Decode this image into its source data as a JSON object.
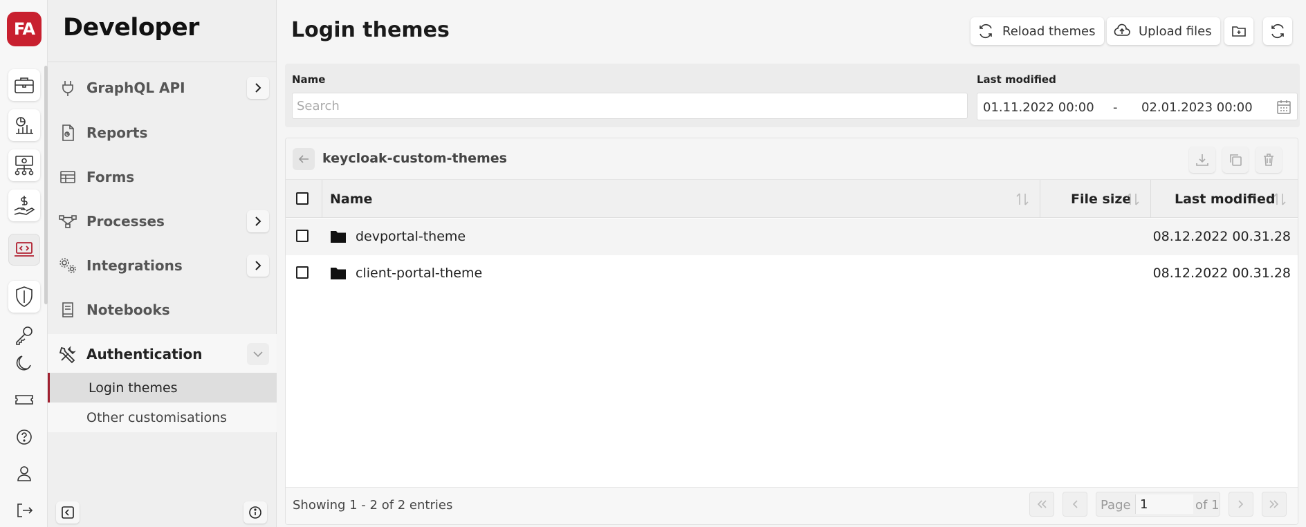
{
  "app": {
    "logo_text": "FA",
    "section_title": "Developer"
  },
  "rail": {
    "icons": [
      "briefcase-icon",
      "reports-chart-icon",
      "money-network-icon",
      "hand-dollar-icon",
      "developer-laptop-icon",
      "shield-icon",
      "key-icon",
      "moon-icon",
      "ticket-icon",
      "help-icon",
      "user-icon",
      "logout-icon"
    ]
  },
  "sidebar": {
    "items": [
      {
        "label": "GraphQL API",
        "icon": "plug-icon"
      },
      {
        "label": "Reports",
        "icon": "report-file-icon"
      },
      {
        "label": "Forms",
        "icon": "table-icon"
      },
      {
        "label": "Processes",
        "icon": "process-icon"
      },
      {
        "label": "Integrations",
        "icon": "gears-icon"
      },
      {
        "label": "Notebooks",
        "icon": "notebook-icon"
      },
      {
        "label": "Authentication",
        "icon": "tools-icon"
      }
    ],
    "subitems": [
      {
        "label": "Login themes"
      },
      {
        "label": "Other customisations"
      }
    ]
  },
  "page": {
    "title": "Login themes",
    "reload_label": "Reload themes",
    "upload_label": "Upload files"
  },
  "filters": {
    "name_label": "Name",
    "search_placeholder": "Search",
    "modified_label": "Last modified",
    "date_from": "01.11.2022 00:00",
    "date_sep": "-",
    "date_to": "02.01.2023 00:00"
  },
  "browser": {
    "path": "keycloak-custom-themes",
    "columns": {
      "name": "Name",
      "size": "File size",
      "modified": "Last modified"
    },
    "rows": [
      {
        "name": "devportal-theme",
        "size": "",
        "modified": "08.12.2022 00.31.28"
      },
      {
        "name": "client-portal-theme",
        "size": "",
        "modified": "08.12.2022 00.31.28"
      }
    ],
    "showing": "Showing 1 - 2 of 2 entries",
    "page_label": "Page",
    "page_value": "1",
    "page_of": "of 1"
  },
  "colors": {
    "brand": "#c8202f",
    "active_marker": "#a02030"
  }
}
